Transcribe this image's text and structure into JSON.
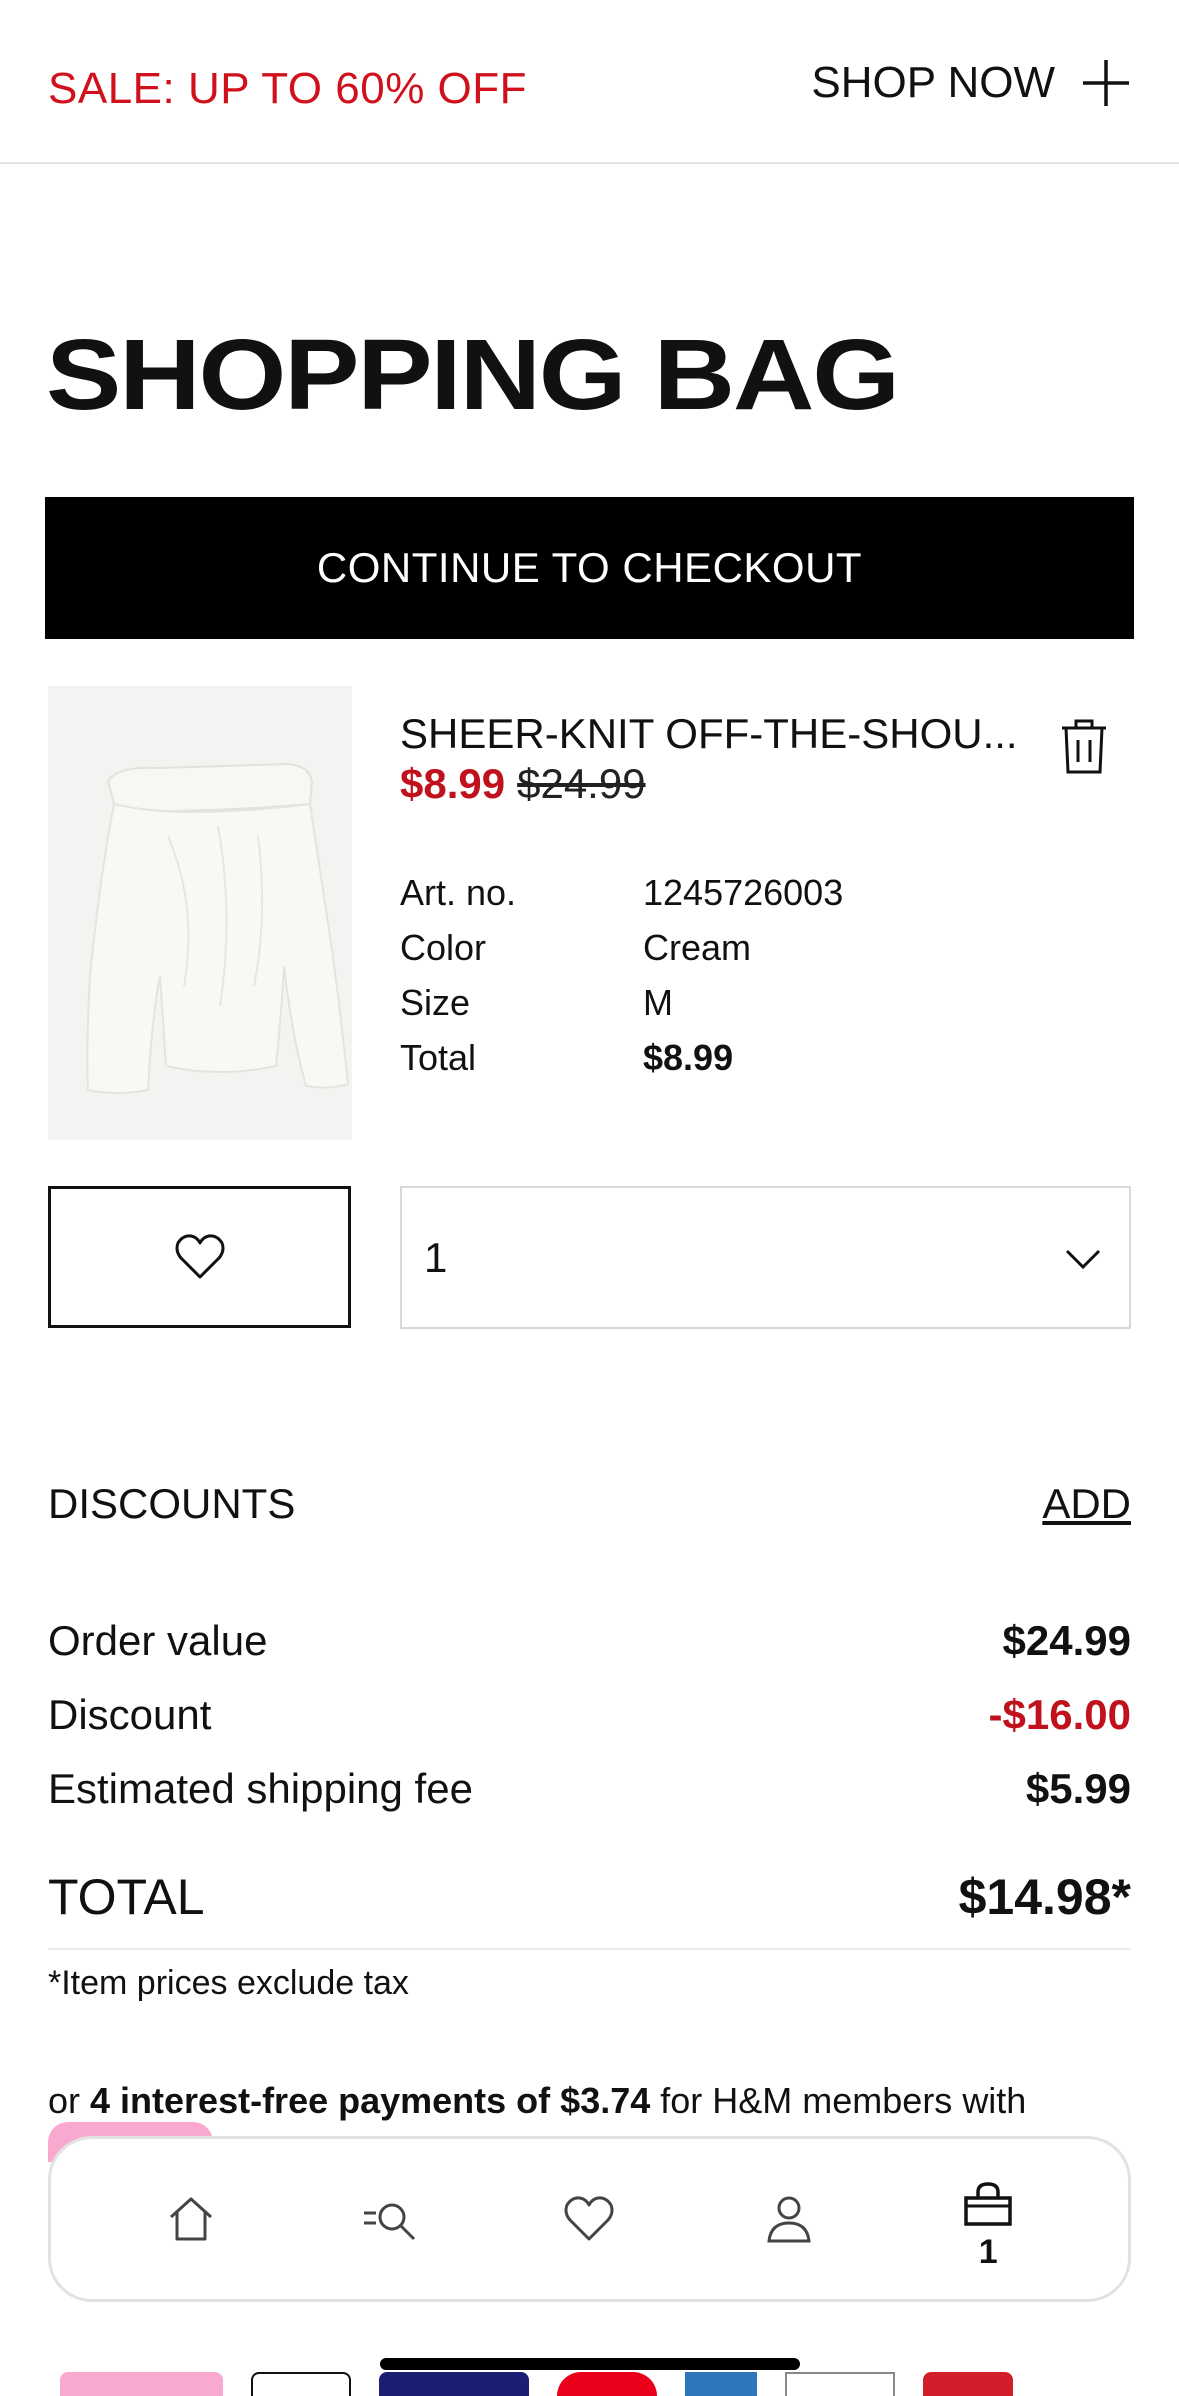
{
  "promo": {
    "sale_text": "SALE: UP TO 60% OFF",
    "shop_label": "SHOP NOW"
  },
  "page_title": "SHOPPING BAG",
  "checkout_label": "CONTINUE TO CHECKOUT",
  "item": {
    "name": "SHEER-KNIT OFF-THE-SHOU...",
    "price_now": "$8.99",
    "price_old": "$24.99",
    "details": [
      {
        "label": "Art. no.",
        "value": "1245726003"
      },
      {
        "label": "Color",
        "value": "Cream"
      },
      {
        "label": "Size",
        "value": "M"
      },
      {
        "label": "Total",
        "value": "$8.99"
      }
    ],
    "quantity": "1"
  },
  "discounts": {
    "label": "DISCOUNTS",
    "add_label": "ADD"
  },
  "summary": {
    "order_value_label": "Order value",
    "order_value": "$24.99",
    "discount_label": "Discount",
    "discount": "-$16.00",
    "shipping_label": "Estimated shipping fee",
    "shipping": "$5.99",
    "total_label": "TOTAL",
    "total": "$14.98*",
    "tax_note": "*Item prices exclude tax"
  },
  "installments": {
    "prefix": "or ",
    "bold": "4 interest-free payments of",
    "amount": " $3.74",
    "suffix": " for H&M members with"
  },
  "tabbar": {
    "bag_count": "1"
  },
  "colors": {
    "sale_red": "#d0111b",
    "price_red": "#c0121d",
    "klarna_pink": "#f9a8d0"
  },
  "icons": [
    "plus-icon",
    "trash-icon",
    "heart-icon",
    "chevron-down-icon",
    "home-icon",
    "search-icon",
    "person-icon",
    "bag-icon"
  ]
}
